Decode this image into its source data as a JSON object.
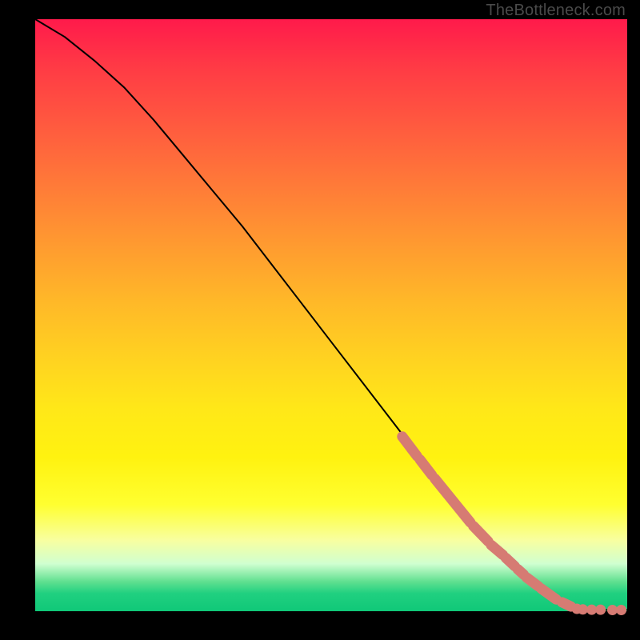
{
  "watermark": "TheBottleneck.com",
  "chart_data": {
    "type": "line",
    "title": "",
    "xlabel": "",
    "ylabel": "",
    "xlim": [
      0,
      100
    ],
    "ylim": [
      0,
      100
    ],
    "series": [
      {
        "name": "curve",
        "x": [
          0,
          5,
          10,
          15,
          20,
          25,
          30,
          35,
          40,
          45,
          50,
          55,
          60,
          65,
          70,
          75,
          80,
          85,
          88,
          90,
          92,
          94,
          96,
          98,
          100
        ],
        "y": [
          100,
          97,
          93,
          88.5,
          83,
          77,
          71,
          65,
          58.5,
          52,
          45.5,
          39,
          32.5,
          26,
          19.5,
          14,
          9,
          4.5,
          2,
          1,
          0.5,
          0.3,
          0.2,
          0.2,
          0.2
        ]
      }
    ],
    "highlight_segments": [
      {
        "x": [
          62,
          64.5
        ],
        "y": [
          29.5,
          26.2
        ]
      },
      {
        "x": [
          65,
          67
        ],
        "y": [
          25.6,
          23
        ]
      },
      {
        "x": [
          67.5,
          73.5
        ],
        "y": [
          22.4,
          15
        ]
      },
      {
        "x": [
          74,
          76.5
        ],
        "y": [
          14.4,
          11.8
        ]
      },
      {
        "x": [
          77,
          79
        ],
        "y": [
          11.2,
          9.5
        ]
      },
      {
        "x": [
          79.5,
          81
        ],
        "y": [
          9,
          7.6
        ]
      },
      {
        "x": [
          81.5,
          82.5
        ],
        "y": [
          7.1,
          6.2
        ]
      },
      {
        "x": [
          83,
          85
        ],
        "y": [
          5.7,
          4.2
        ]
      },
      {
        "x": [
          85.5,
          88
        ],
        "y": [
          3.8,
          2
        ]
      },
      {
        "x": [
          89,
          90.5
        ],
        "y": [
          1.5,
          0.8
        ]
      }
    ],
    "highlight_dots": [
      {
        "x": 91.5,
        "y": 0.4
      },
      {
        "x": 92.5,
        "y": 0.3
      },
      {
        "x": 94,
        "y": 0.25
      },
      {
        "x": 95.5,
        "y": 0.25
      },
      {
        "x": 97.5,
        "y": 0.2
      },
      {
        "x": 99,
        "y": 0.2
      }
    ]
  }
}
